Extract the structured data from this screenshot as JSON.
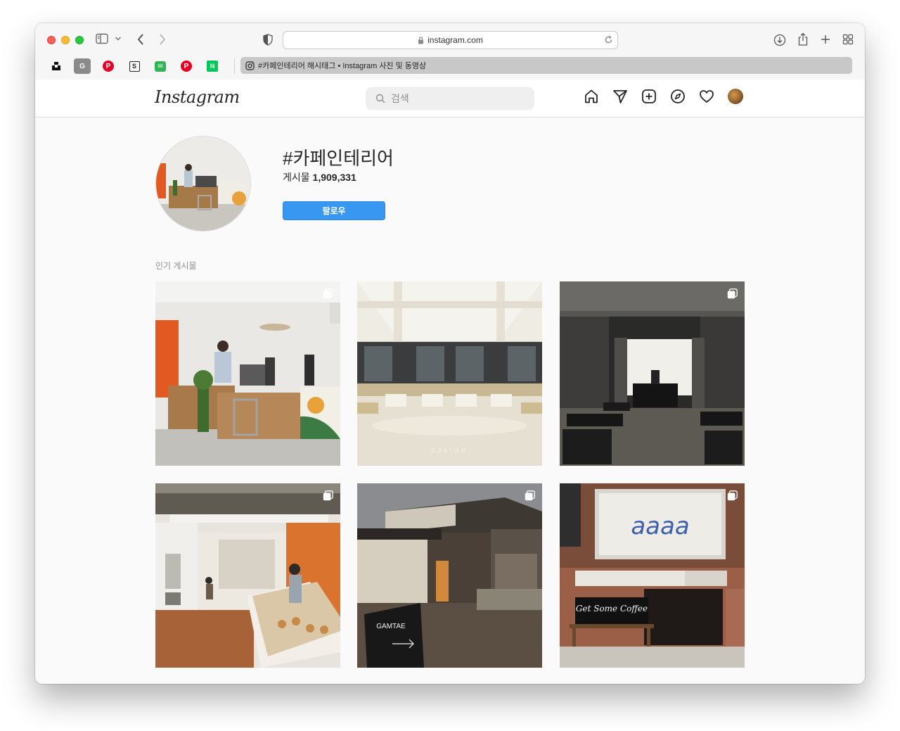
{
  "browser": {
    "url": "instagram.com",
    "tab_title": "#카페인테리어 해시태그 • Instagram 사진 및 동영상",
    "bookmarks": [
      {
        "icon": "unsplash-icon",
        "color": "#111111",
        "glyph": ""
      },
      {
        "icon": "google-icon",
        "color": "#8a8a8a",
        "glyph": "G"
      },
      {
        "icon": "pinterest-icon",
        "color": "#e60023",
        "glyph": "P"
      },
      {
        "icon": "s-bookmark-icon",
        "color": "#ffffff",
        "glyph": "S"
      },
      {
        "icon": "mail-bookmark-icon",
        "color": "#2fb554",
        "glyph": "✉"
      },
      {
        "icon": "pinterest-icon",
        "color": "#e60023",
        "glyph": "P"
      },
      {
        "icon": "naver-icon",
        "color": "#03c75a",
        "glyph": "N"
      }
    ]
  },
  "instagram": {
    "logo": "Instagram",
    "search_placeholder": "검색",
    "hashtag": "#카페인테리어",
    "post_count_label": "게시물",
    "post_count": "1,909,331",
    "follow_label": "팔로우",
    "popular_label": "인기 게시물",
    "accent_color": "#3897f0"
  },
  "posts": [
    {
      "subject": "cafe counter with barista",
      "multi": true
    },
    {
      "subject": "white beamed hall with tables",
      "multi": false
    },
    {
      "subject": "dark concrete cafe interior",
      "multi": true
    },
    {
      "subject": "bakery with orange walls",
      "multi": true
    },
    {
      "subject": "brick building with GAMTAE sign",
      "multi": true,
      "sign_text": "GAMTAE"
    },
    {
      "subject": "brick storefront with neon sign",
      "multi": true,
      "sign_text": "aaaa",
      "board_text": "Get Some Coffee"
    }
  ],
  "post2_watermark": "D3SIGN"
}
